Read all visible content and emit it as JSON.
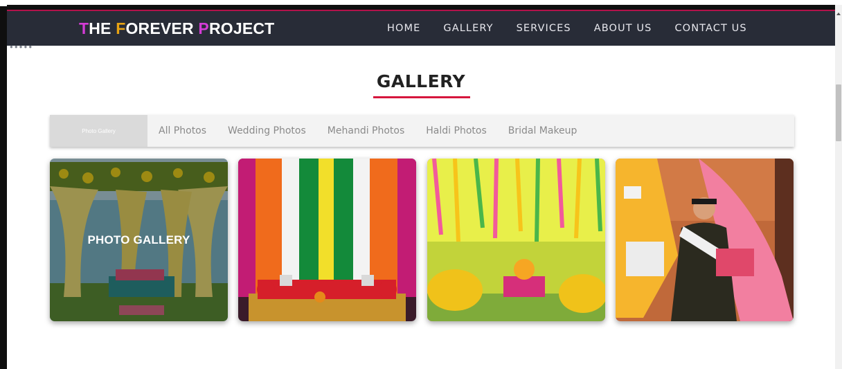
{
  "brand": {
    "parts": [
      "T",
      "HE ",
      "F",
      "OREVER ",
      "P",
      "ROJECT"
    ]
  },
  "nav": {
    "items": [
      "HOME",
      "GALLERY",
      "SERVICES",
      "ABOUT US",
      "CONTACT US"
    ]
  },
  "gallery": {
    "title": "GALLERY",
    "tabs": [
      "Photo Gallery",
      "All Photos",
      "Wedding Photos",
      "Mehandi Photos",
      "Haldi Photos",
      "Bridal Makeup"
    ],
    "cards": [
      {
        "label": "PHOTO GALLERY"
      }
    ]
  },
  "colors": {
    "navbar": "#282c37",
    "accent": "#d6163d",
    "brand_highlight": "#d43cd6"
  },
  "icons": {
    "scroll_up": "scroll-up-arrow-icon"
  }
}
